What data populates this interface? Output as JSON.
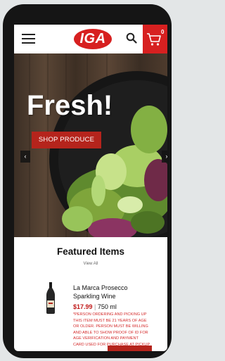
{
  "header": {
    "logo_text": "IGA",
    "cart_count": "0",
    "menu_icon": "hamburger-menu-icon",
    "search_icon": "search-icon",
    "cart_icon": "shopping-cart-icon"
  },
  "hero": {
    "title": "Fresh!",
    "button_label": "SHOP PRODUCE",
    "prev_arrow": "‹",
    "next_arrow": "›"
  },
  "featured": {
    "title": "Featured Items",
    "view_all": "View All"
  },
  "product": {
    "name": "La Marca Prosecco Sparkling Wine",
    "price": "$17.99",
    "separator": "|",
    "size": "750 ml",
    "notice": "*PERSON ORDERING AND PICKING UP THIS ITEM MUST BE 21 YEARS OF AGE OR OLDER. PERSON MUST BE WILLING AND ABLE TO SHOW PROOF OF ID FOR AGE VERIFICATION AND PAYMENT CARD USED FOR PURCHASE AT PICKUP"
  },
  "colors": {
    "brand_red": "#d72020",
    "button_red": "#b5241c",
    "notice_red": "#d42a2a"
  }
}
